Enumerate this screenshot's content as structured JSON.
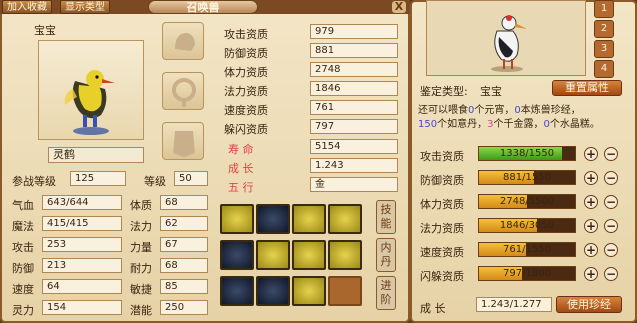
{
  "top": {
    "add_favorite": "加入收藏",
    "show_type": "显示类型",
    "title": "召唤兽",
    "close": "X"
  },
  "left": {
    "baby_label": "宝宝",
    "pet_name": "灵鹤",
    "participation_level_label": "参战等级",
    "participation_level": "125",
    "level_label": "等级",
    "level": "50",
    "stats": [
      {
        "label": "气血",
        "value": "643/644"
      },
      {
        "label": "魔法",
        "value": "415/415"
      },
      {
        "label": "攻击",
        "value": "253"
      },
      {
        "label": "防御",
        "value": "213"
      },
      {
        "label": "速度",
        "value": "64"
      },
      {
        "label": "灵力",
        "value": "154"
      }
    ],
    "attrs": [
      {
        "label": "体质",
        "value": "68"
      },
      {
        "label": "法力",
        "value": "62"
      },
      {
        "label": "力量",
        "value": "67"
      },
      {
        "label": "耐力",
        "value": "68"
      },
      {
        "label": "敏捷",
        "value": "85"
      },
      {
        "label": "潜能",
        "value": "250"
      }
    ],
    "aptitudes": [
      {
        "label": "攻击资质",
        "value": "979"
      },
      {
        "label": "防御资质",
        "value": "881"
      },
      {
        "label": "体力资质",
        "value": "2748"
      },
      {
        "label": "法力资质",
        "value": "1846"
      },
      {
        "label": "速度资质",
        "value": "761"
      },
      {
        "label": "躲闪资质",
        "value": "797"
      }
    ],
    "life_label": "寿 命",
    "life": "5154",
    "growth_label": "成 长",
    "growth": "1.243",
    "element_label": "五 行",
    "element": "金",
    "tabs": [
      "技能",
      "内丹",
      "进阶"
    ]
  },
  "right": {
    "tabs": [
      "1",
      "2",
      "3",
      "4"
    ],
    "identify_label": "鉴定类型:",
    "identify_value": "宝宝",
    "reset_button": "重置属性",
    "info_line1_a": "还可以喂食",
    "info_line1_b": "0",
    "info_line1_c": "个元宵，",
    "info_line1_d": "0",
    "info_line1_e": "本炼兽珍经，",
    "info_line2_a": "150",
    "info_line2_b": "个如意丹，",
    "info_line2_c": "3",
    "info_line2_d": "个千金露，",
    "info_line2_e": "0",
    "info_line2_f": "个水晶糕。",
    "bars": [
      {
        "label": "攻击资质",
        "text": "1338/1550",
        "fill": 0.863,
        "color": "green"
      },
      {
        "label": "防御资质",
        "text": "881/1550",
        "fill": 0.568,
        "color": "orange"
      },
      {
        "label": "体力资质",
        "text": "2748/5500",
        "fill": 0.5,
        "color": "orange"
      },
      {
        "label": "法力资质",
        "text": "1846/3050",
        "fill": 0.605,
        "color": "orange"
      },
      {
        "label": "速度资质",
        "text": "761/1550",
        "fill": 0.491,
        "color": "orange"
      },
      {
        "label": "闪躲资质",
        "text": "797/1800",
        "fill": 0.443,
        "color": "orange"
      }
    ],
    "growth_label": "成 长",
    "growth_value": "1.243/1.277",
    "use_button": "使用珍经"
  }
}
